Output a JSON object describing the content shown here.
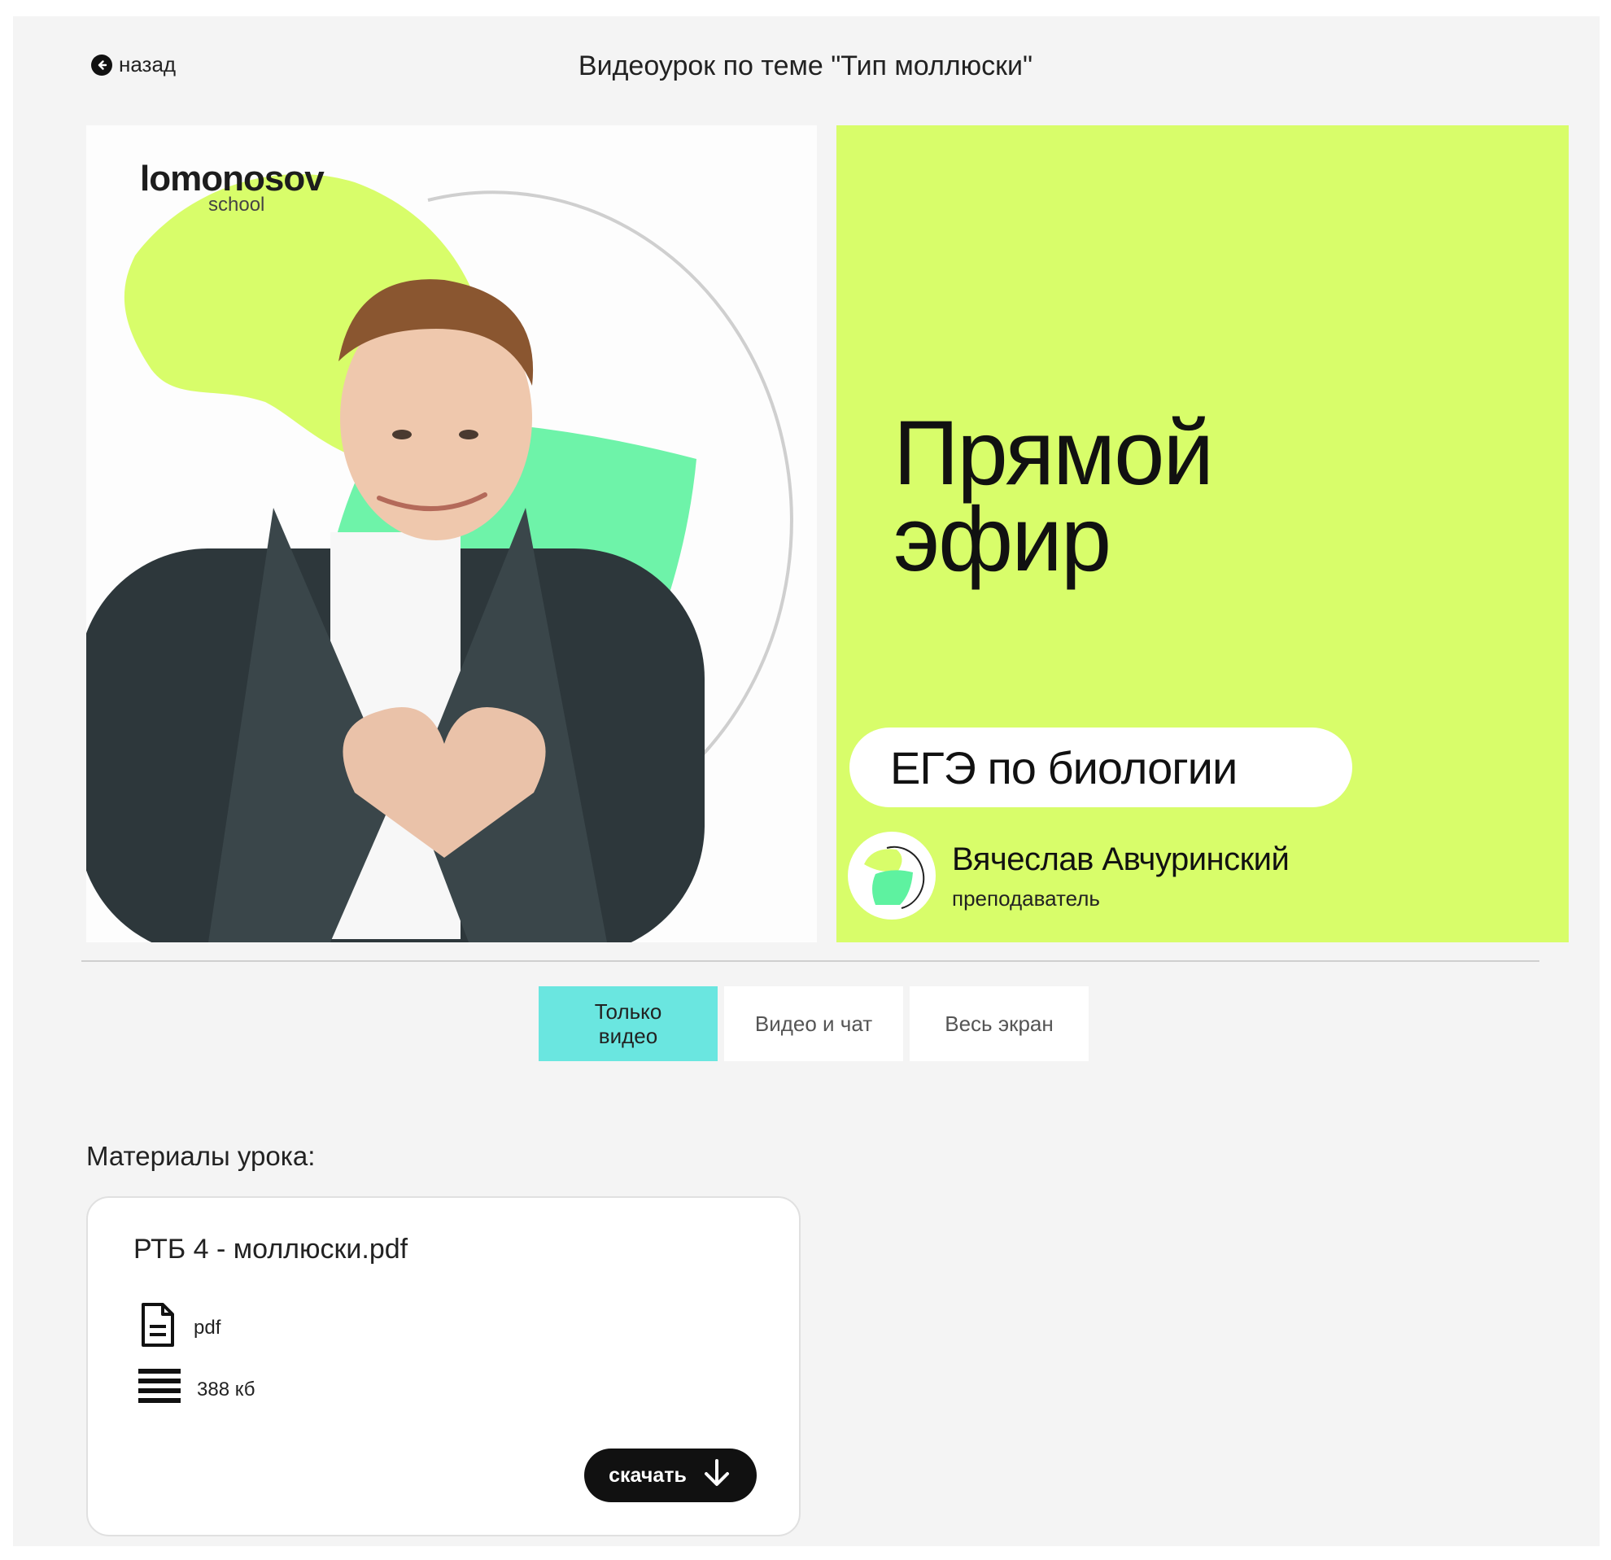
{
  "header": {
    "back_label": "назад",
    "title": "Видеоурок по теме \"Тип моллюски\""
  },
  "video": {
    "logo_main": "lomonosov",
    "logo_sub": "school",
    "live_line1": "Прямой",
    "live_line2": "эфир",
    "subject": "ЕГЭ по биологии",
    "teacher_name": "Вячеслав Авчуринский",
    "teacher_role": "преподаватель",
    "colors": {
      "accent": "#d8fd6a",
      "mint": "#5ef2a0"
    }
  },
  "view_modes": [
    {
      "label": "Только видео",
      "active": true
    },
    {
      "label": "Видео и чат",
      "active": false
    },
    {
      "label": "Весь экран",
      "active": false
    }
  ],
  "materials": {
    "title": "Материалы урока:",
    "files": [
      {
        "name": "РТБ 4 - моллюски.pdf",
        "type": "pdf",
        "size": "388 кб",
        "download_label": "скачать",
        "type_icon": "document-icon",
        "size_icon": "lines-icon",
        "download_icon": "arrow-down-icon"
      }
    ]
  },
  "colors": {
    "active_mode": "#6ae6e0",
    "page_bg": "#f4f4f4",
    "button_dark": "#111111"
  }
}
